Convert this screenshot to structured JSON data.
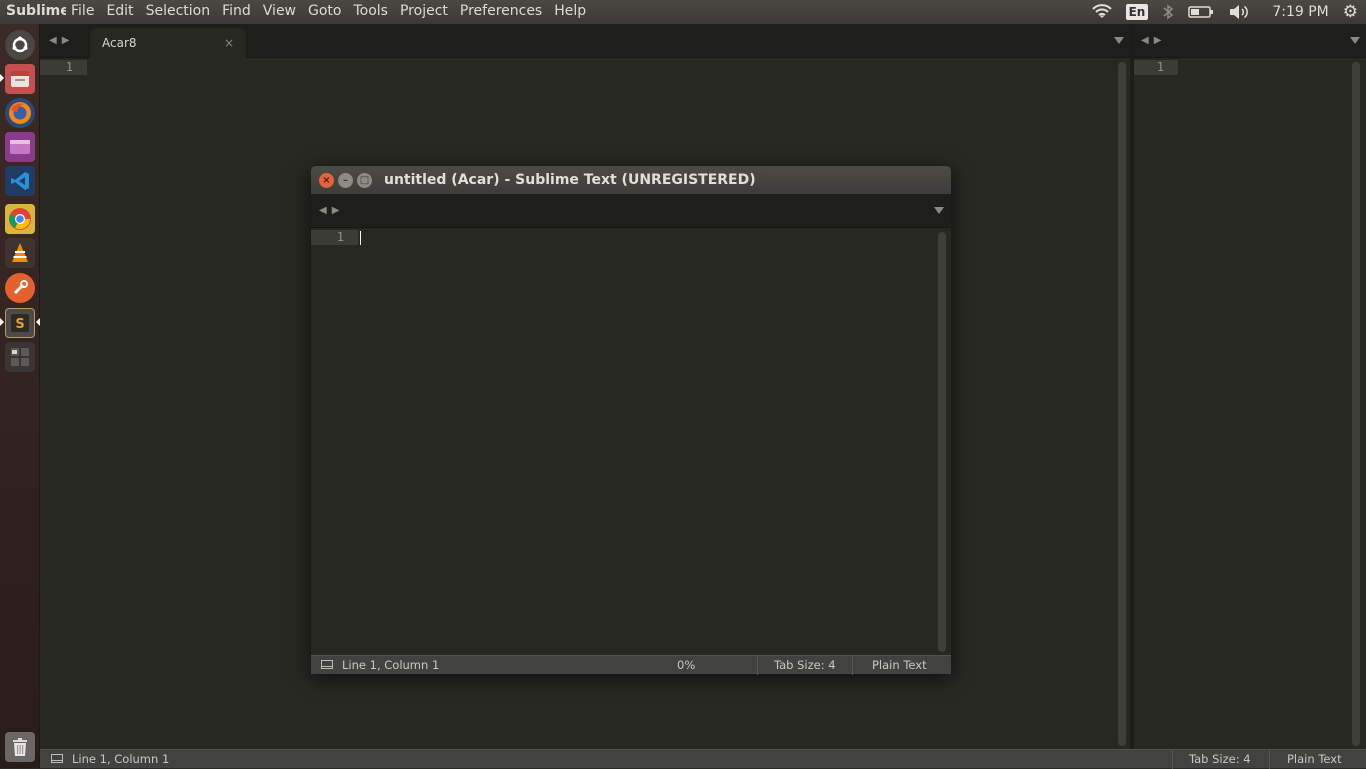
{
  "topbar": {
    "app_name": "Sublime Text",
    "menus": [
      "File",
      "Edit",
      "Selection",
      "Find",
      "View",
      "Goto",
      "Tools",
      "Project",
      "Preferences",
      "Help"
    ],
    "language": "En",
    "time": "7:19 PM"
  },
  "launcher": {
    "items": [
      "Ubuntu Dash",
      "Files",
      "Firefox",
      "Software Center",
      "Visual Studio Code",
      "Chrome",
      "VLC",
      "Software Updater",
      "Sublime Text",
      "Workspace Switcher",
      "Trash"
    ]
  },
  "main_window": {
    "tab_label": "Acar8",
    "close_glyph": "×",
    "line_number": "1",
    "right_line_number": "1",
    "status": {
      "position": "Line 1, Column 1",
      "tab_size": "Tab Size: 4",
      "syntax": "Plain Text"
    }
  },
  "floating_window": {
    "title": "untitled (Acar) - Sublime Text (UNREGISTERED)",
    "line_number": "1",
    "status": {
      "position": "Line 1, Column 1",
      "percent": "0%",
      "tab_size": "Tab Size: 4",
      "syntax": "Plain Text"
    }
  },
  "colors": {
    "editor_bg": "#272822",
    "tabbar_bg": "#1e1f1b",
    "close_button": "#e2643a"
  }
}
